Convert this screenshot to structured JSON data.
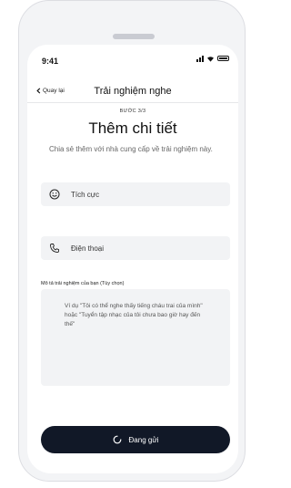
{
  "status_bar": {
    "time": "9:41"
  },
  "nav": {
    "back_label": "Quay lại",
    "title": "Trải nghiệm nghe"
  },
  "step": "BƯỚC 3/3",
  "heading": "Thêm chi tiết",
  "subtitle": "Chia sẻ thêm với nhà cung cấp về trải nghiệm này.",
  "options": [
    {
      "label": "Tích cực",
      "icon": "smiley-icon"
    },
    {
      "label": "Điện thoại",
      "icon": "phone-icon"
    }
  ],
  "textarea": {
    "label": "Mô tả trải nghiệm của bạn (Tùy chọn)",
    "placeholder": "Ví dụ \"Tôi có thể nghe thấy tiếng cháu trai của mình\" hoặc \"Tuyển tập nhạc của tôi chưa bao giờ hay đến thế\""
  },
  "submit": {
    "label": "Đang gửi",
    "icon": "loading-spinner-icon"
  }
}
